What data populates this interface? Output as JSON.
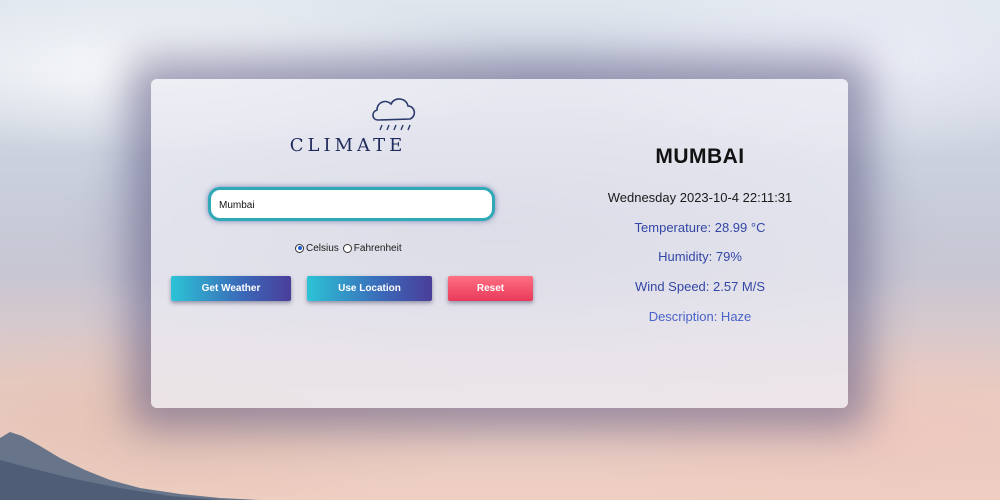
{
  "app": {
    "logo_text": "CLIMATE"
  },
  "search": {
    "value": "Mumbai"
  },
  "units": {
    "options": [
      {
        "label": "Celsius",
        "selected": true
      },
      {
        "label": "Fahrenheit",
        "selected": false
      }
    ]
  },
  "buttons": {
    "get_weather": "Get Weather",
    "use_location": "Use Location",
    "reset": "Reset"
  },
  "weather": {
    "city": "MUMBAI",
    "datetime": "Wednesday 2023-10-4 22:11:31",
    "temperature": "Temperature: 28.99 °C",
    "humidity": "Humidity: 79%",
    "wind_speed": "Wind Speed: 2.57 M/S",
    "description": "Description: Haze"
  },
  "icons": {
    "logo": "cloud-rain-icon"
  },
  "colors": {
    "accent_teal": "#2fa8b8",
    "button_gradient_start": "#2cc3d6",
    "button_gradient_end": "#4a3e9a",
    "reset_red": "#e83a5a",
    "info_blue": "#3346a6",
    "logo_navy": "#1f2a5c"
  }
}
